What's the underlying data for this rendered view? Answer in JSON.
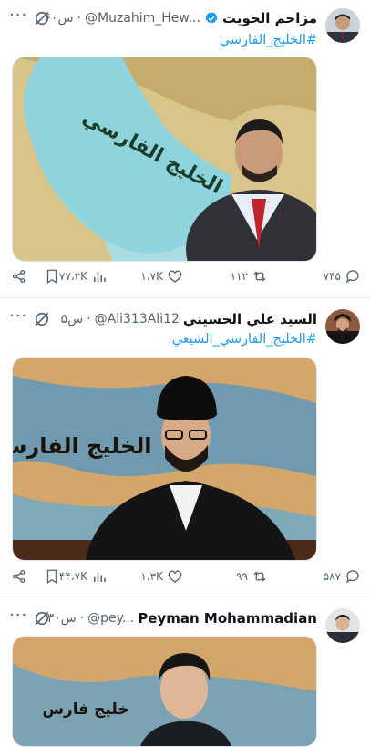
{
  "tweets": [
    {
      "name": "مزاحم الحويت",
      "handle": "@Muzahim_Hew...",
      "time": "۶۰س",
      "hashtag": "#الخليج_الفارسي",
      "image_text": "الخليج الفارسي",
      "stats": {
        "replies": "۷۴۵",
        "retweets": "۱۱۲",
        "likes": "۱،۷K",
        "views": "۷۷،۲K"
      }
    },
    {
      "name": "السيد علي الحسيني",
      "handle": "@Ali313Ali12",
      "time": "۵س",
      "hashtag": "#الخليج_الفارسي_الشيعي",
      "image_text": "الخليج الفارسي",
      "stats": {
        "replies": "۵۸۷",
        "retweets": "۹۹",
        "likes": "۱،۳K",
        "views": "۴۴،۷K"
      }
    },
    {
      "name": "Peyman Mohammadian",
      "handle": "@pey...",
      "time": "۳۰س",
      "image_text": "خلیج فارس"
    }
  ],
  "colors": {
    "link": "#1d9bf0",
    "verified": "#1d9bf0",
    "muted": "#536471"
  },
  "icons": [
    "verified-badge-icon",
    "grok-icon",
    "more-icon",
    "reply-icon",
    "retweet-icon",
    "like-icon",
    "views-icon",
    "bookmark-icon",
    "share-icon"
  ]
}
